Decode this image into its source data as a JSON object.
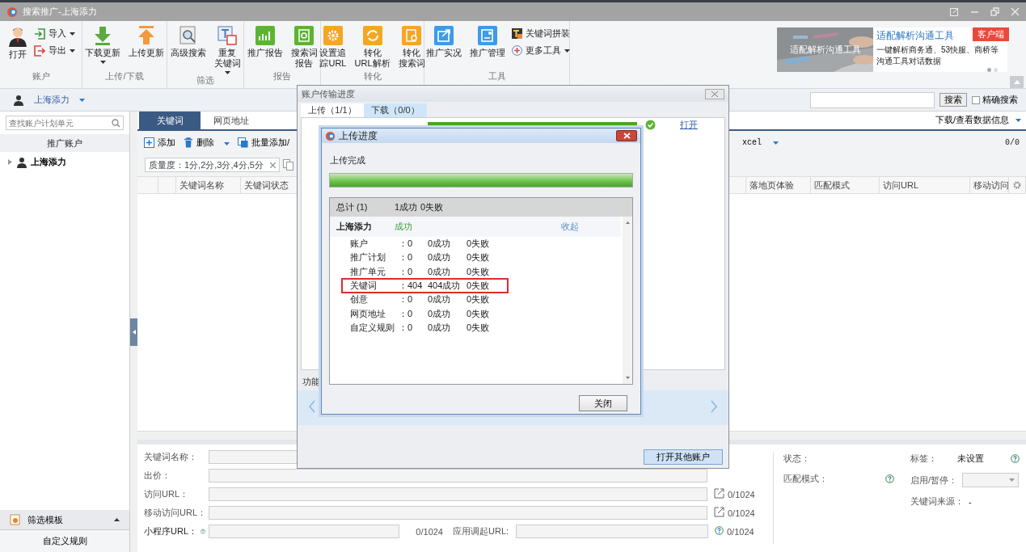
{
  "window": {
    "title": "搜索推广-上海添力"
  },
  "ribbon": {
    "groups": [
      {
        "label": "账户",
        "items": [
          {
            "kind": "large",
            "label": [
              "打开"
            ],
            "dropdown": false
          },
          {
            "kind": "small",
            "label": [
              "导入"
            ],
            "dropdown": true
          },
          {
            "kind": "small",
            "label": [
              "导出"
            ],
            "dropdown": true
          }
        ]
      },
      {
        "label": "上传/下载",
        "items": [
          {
            "kind": "large",
            "label": [
              "下载更新"
            ],
            "dropdown": true
          },
          {
            "kind": "large",
            "label": [
              "上传更新"
            ],
            "dropdown": false
          }
        ]
      },
      {
        "label": "筛选",
        "items": [
          {
            "kind": "large",
            "label": [
              "高级搜索"
            ],
            "dropdown": false
          },
          {
            "kind": "large",
            "label": [
              "重复",
              "关键词"
            ],
            "dropdown": true
          }
        ]
      },
      {
        "label": "报告",
        "items": [
          {
            "kind": "large",
            "label": [
              "推广报告"
            ],
            "dropdown": false
          },
          {
            "kind": "large",
            "label": [
              "搜索词",
              "报告"
            ],
            "dropdown": false
          }
        ]
      },
      {
        "label": "转化",
        "items": [
          {
            "kind": "large",
            "label": [
              "设置追",
              "踪URL"
            ],
            "dropdown": false
          },
          {
            "kind": "large",
            "label": [
              "转化",
              "URL解析"
            ],
            "dropdown": false
          },
          {
            "kind": "large",
            "label": [
              "转化",
              "搜索词"
            ],
            "dropdown": false
          }
        ]
      },
      {
        "label": "工具",
        "items": [
          {
            "kind": "large",
            "label": [
              "推广实况"
            ],
            "dropdown": false
          },
          {
            "kind": "large",
            "label": [
              "推广管理"
            ],
            "dropdown": false
          },
          {
            "kind": "small",
            "label": [
              "关键词拼装"
            ],
            "dropdown": false
          },
          {
            "kind": "small",
            "label": [
              "更多工具"
            ],
            "dropdown": true
          }
        ]
      }
    ]
  },
  "ad": {
    "overlay": "适配解析沟通工具",
    "title": "适配解析沟通工具",
    "badge": "客户端",
    "description": "一键解析商务通、53快服、商桥等沟通工具对话数据",
    "slides": [
      {
        "selected": true
      },
      {
        "selected": false
      }
    ]
  },
  "account_bar": {
    "account": "上海添力",
    "search_button": "搜索",
    "exact_search": {
      "label": "精确搜索",
      "checked": false
    }
  },
  "sidebar": {
    "search": {
      "placeholder": "查找账户计划单元"
    },
    "header": "推广账户",
    "tree": [
      {
        "label": "上海添力",
        "expanded": false
      }
    ],
    "bottom": [
      {
        "label": "筛选模板",
        "kind": "panel"
      },
      {
        "label": "自定义规则",
        "kind": "item"
      }
    ]
  },
  "tabs": [
    {
      "label": "关键词",
      "selected": true
    },
    {
      "label": "网页地址",
      "selected": false
    }
  ],
  "data_menu": "下载/查看数据信息",
  "toolbar": {
    "items": [
      {
        "label": "添加",
        "dropdown": false
      },
      {
        "label": "删除",
        "dropdown": true
      },
      {
        "label": "批量添加/",
        "dropdown": false
      }
    ],
    "export": "xcel",
    "count": "0/0"
  },
  "filter": {
    "chip": "质量度：1分,2分,3分,4分,5分"
  },
  "table": {
    "columns": [
      {
        "label": "关键词名称"
      },
      {
        "label": "关键词状态"
      },
      {
        "label": "落地页体验"
      },
      {
        "label": "匹配模式"
      },
      {
        "label": "访问URL"
      },
      {
        "label": "移动访问"
      }
    ]
  },
  "details": {
    "fields": [
      {
        "label": "关键词名称：",
        "kind": "text"
      },
      {
        "label": "出价：",
        "kind": "text"
      },
      {
        "label": "访问URL：",
        "kind": "url",
        "counter": "0/1024"
      },
      {
        "label": "移动访问URL：",
        "kind": "url",
        "counter": "0/1024"
      },
      {
        "label": "小程序URL：",
        "kind": "split",
        "counter": "0/1024",
        "second_label": "应用调起URL:",
        "second_counter": "0/1024"
      }
    ],
    "side": [
      {
        "label": "状态：",
        "kind": "plain"
      },
      {
        "label": "匹配模式：",
        "kind": "help"
      }
    ],
    "side2": [
      {
        "label": "标签：",
        "value": "未设置",
        "kind": "help"
      },
      {
        "label": "启用/暂停：",
        "kind": "select"
      },
      {
        "label": "关键词来源：",
        "value": "-",
        "kind": "plain"
      }
    ]
  },
  "transfer_dialog": {
    "title": "账户传输进度",
    "tabs": [
      {
        "label": "上传（1/1）",
        "selected": true
      },
      {
        "label": "下载（0/0）",
        "selected": false
      }
    ],
    "row": {
      "level": 1,
      "link": "打开"
    },
    "footer_text": "功能",
    "button": "打开其他账户"
  },
  "upload_dialog": {
    "title": "上传进度",
    "status": "上传完成",
    "level": 1,
    "summary": {
      "label": "总计 (1)",
      "success": "1成功",
      "fail": "0失败"
    },
    "account": {
      "name": "上海添力",
      "status": "成功",
      "toggle": "收起"
    },
    "rows": [
      {
        "label": "账户",
        "count": "：0",
        "success": "0成功",
        "fail": "0失败",
        "highlighted": false
      },
      {
        "label": "推广计划",
        "count": "：0",
        "success": "0成功",
        "fail": "0失败",
        "highlighted": false
      },
      {
        "label": "推广单元",
        "count": "：0",
        "success": "0成功",
        "fail": "0失败",
        "highlighted": false
      },
      {
        "label": "关键词",
        "count": "：404",
        "success": "404成功",
        "fail": "0失败",
        "highlighted": true
      },
      {
        "label": "创意",
        "count": "：0",
        "success": "0成功",
        "fail": "0失败",
        "highlighted": false
      },
      {
        "label": "网页地址",
        "count": "：0",
        "success": "0成功",
        "fail": "0失败",
        "highlighted": false
      },
      {
        "label": "自定义规则",
        "count": "：0",
        "success": "0成功",
        "fail": "0失败",
        "highlighted": false
      }
    ],
    "button": "关闭"
  }
}
